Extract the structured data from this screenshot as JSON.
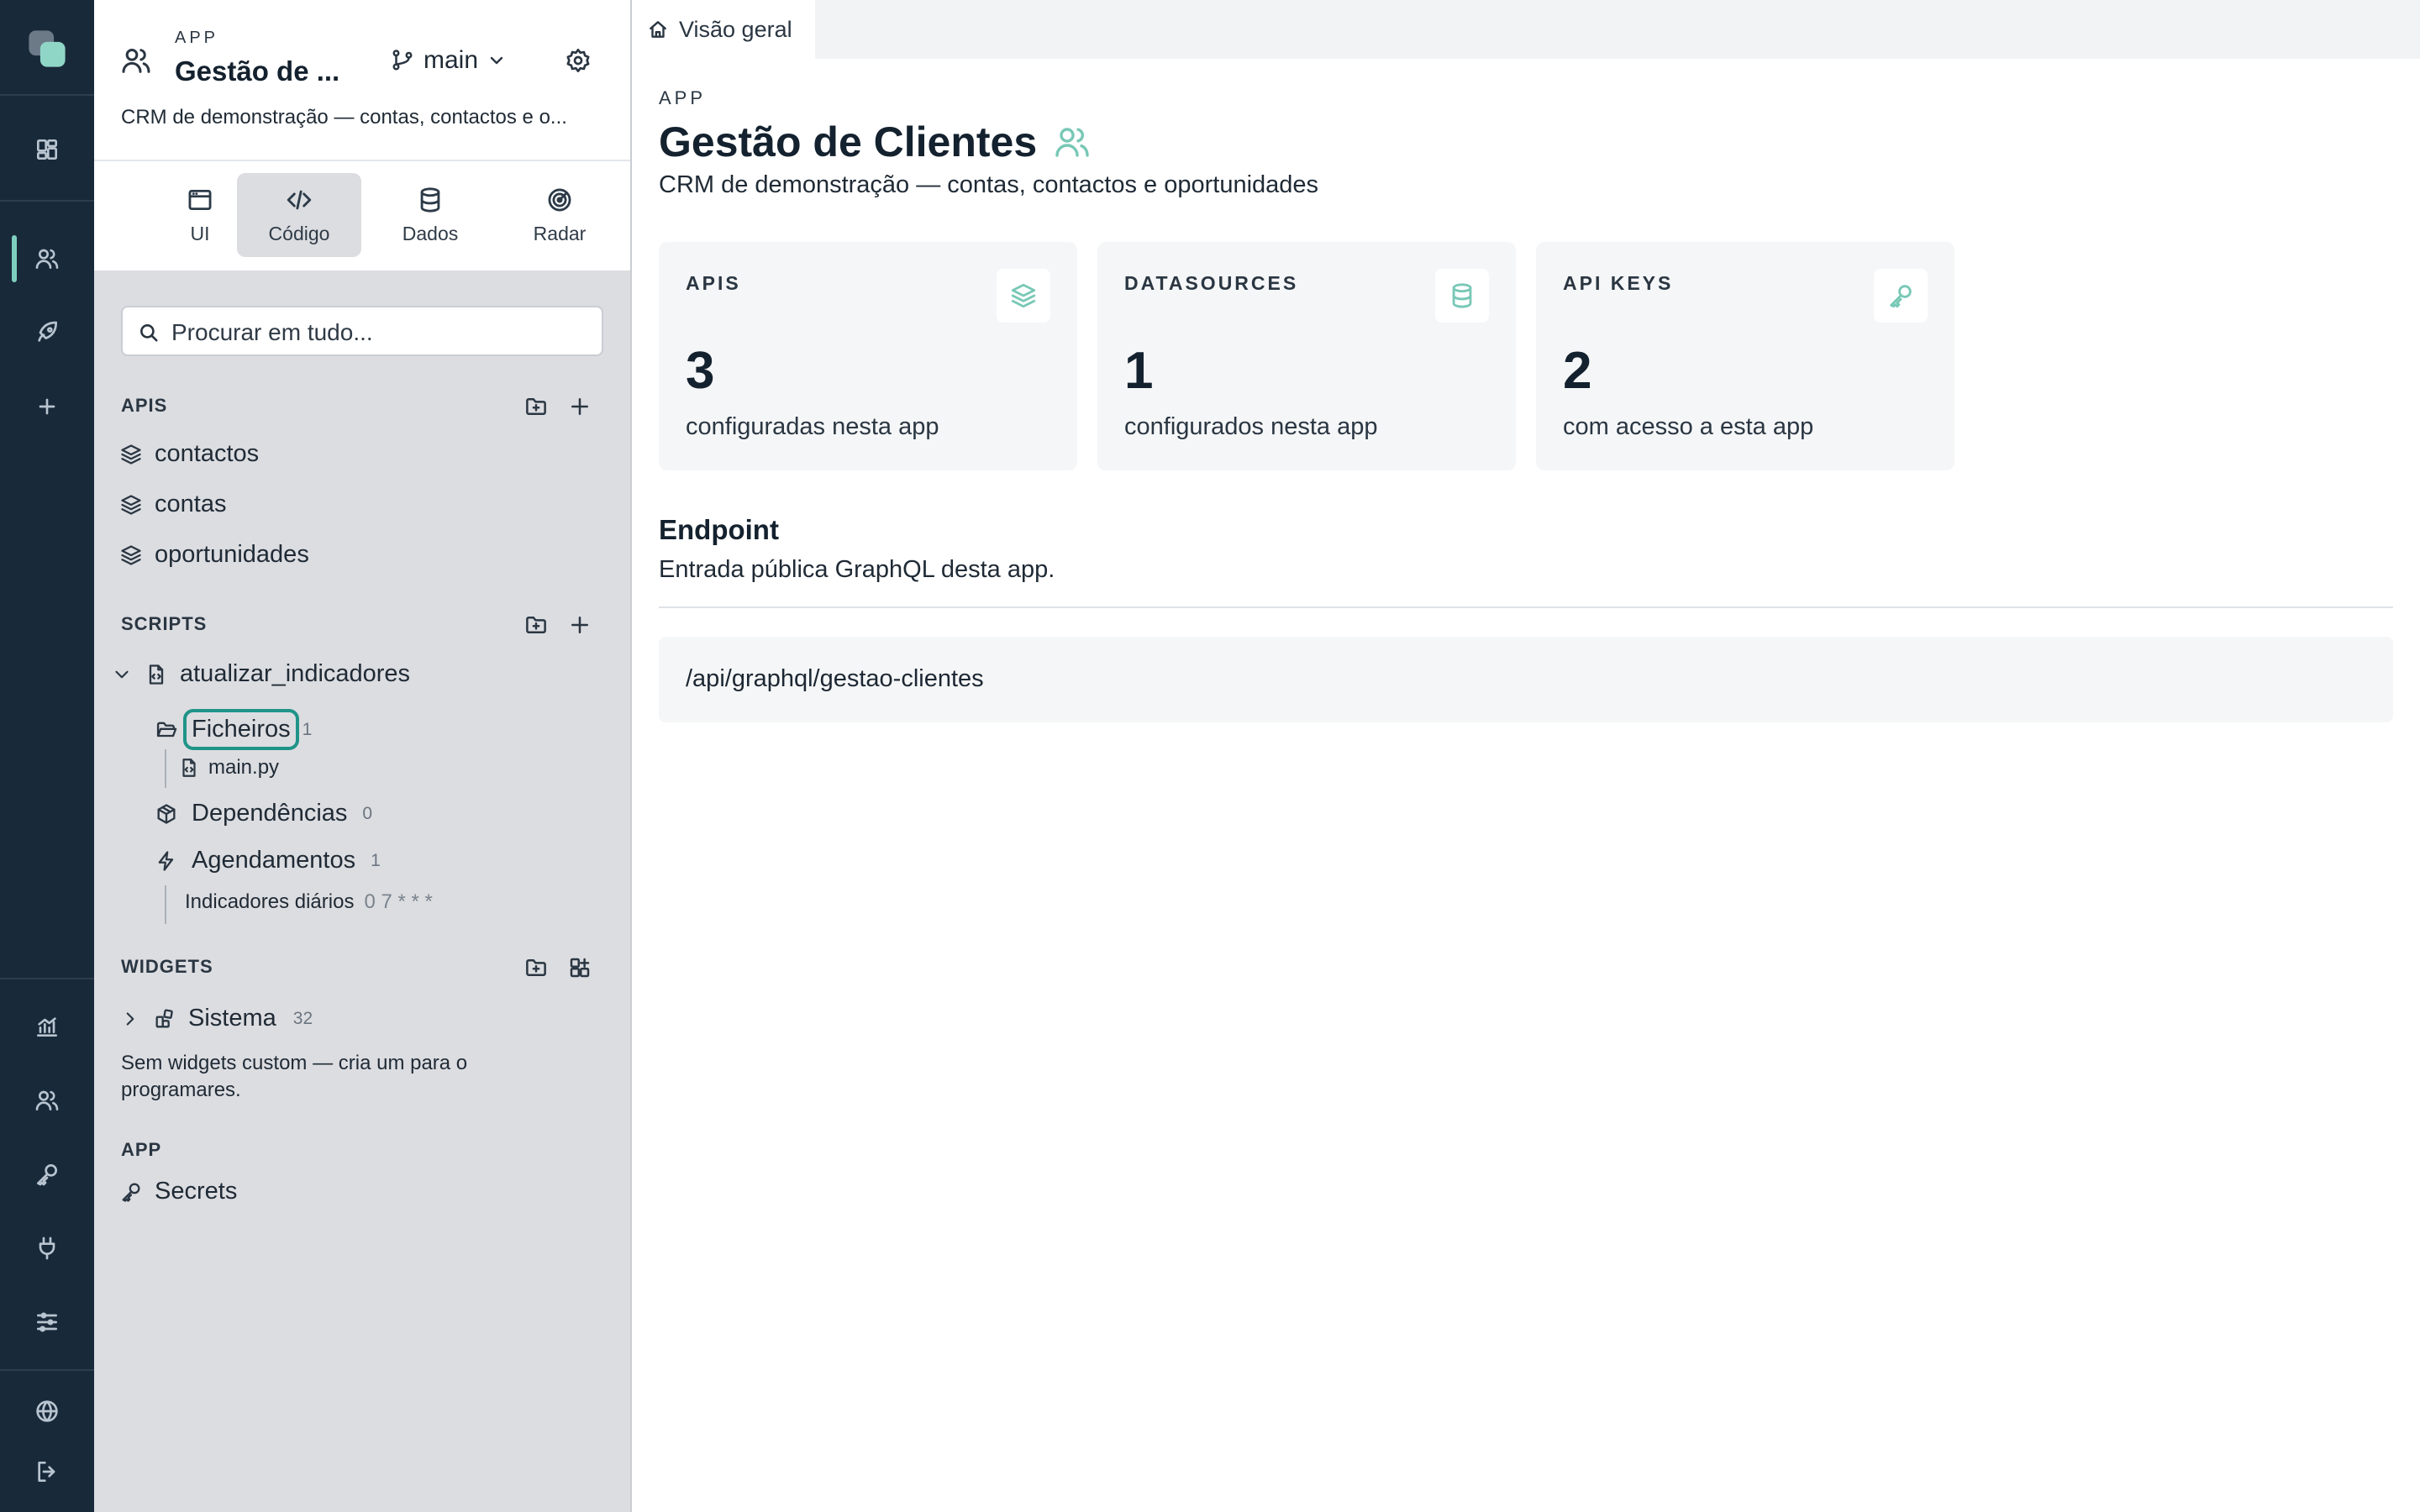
{
  "rail": {
    "icons": [
      "app-logo-icon",
      "dashboard-icon",
      "users-icon",
      "rocket-icon",
      "plus-icon",
      "chart-icon",
      "team-icon",
      "key-icon",
      "plug-icon",
      "sliders-icon",
      "globe-icon",
      "logout-icon"
    ]
  },
  "sidebar": {
    "app_kicker": "APP",
    "app_name": "Gestão de ...",
    "branch": "main",
    "description": "CRM de demonstração — contas, contactos e o...",
    "tabs": [
      {
        "label": "UI"
      },
      {
        "label": "Código"
      },
      {
        "label": "Dados"
      },
      {
        "label": "Radar"
      }
    ],
    "active_tab": "Código",
    "search_placeholder": "Procurar em tudo...",
    "apis": {
      "title": "APIS",
      "items": [
        {
          "label": "contactos"
        },
        {
          "label": "contas"
        },
        {
          "label": "oportunidades"
        }
      ]
    },
    "scripts": {
      "title": "SCRIPTS",
      "script_name": "atualizar_indicadores",
      "files_label": "Ficheiros",
      "files_count": "1",
      "file_name": "main.py",
      "deps_label": "Dependências",
      "deps_count": "0",
      "schedules_label": "Agendamentos",
      "schedules_count": "1",
      "schedule_name": "Indicadores diários",
      "schedule_cron": "0 7 * * *"
    },
    "widgets": {
      "title": "WIDGETS",
      "group_label": "Sistema",
      "group_count": "32",
      "empty_text": "Sem widgets custom — cria um para o programares."
    },
    "app_section": {
      "title": "APP",
      "secrets_label": "Secrets"
    }
  },
  "main": {
    "tab_label": "Visão geral",
    "kicker": "APP",
    "title": "Gestão de Clientes",
    "subtitle": "CRM de demonstração — contas, contactos e oportunidades",
    "cards": [
      {
        "title": "APIS",
        "value": "3",
        "caption": "configuradas nesta app",
        "icon": "layers-icon"
      },
      {
        "title": "DATASOURCES",
        "value": "1",
        "caption": "configurados nesta app",
        "icon": "database-icon"
      },
      {
        "title": "API KEYS",
        "value": "2",
        "caption": "com acesso a esta app",
        "icon": "key-icon"
      }
    ],
    "endpoint": {
      "title": "Endpoint",
      "description": "Entrada pública GraphQL desta app.",
      "url": "/api/graphql/gestao-clientes"
    }
  },
  "colors": {
    "rail_bg": "#18293a",
    "accent": "#78c8b6",
    "sidebar_bg": "#dcdde1",
    "focus_ring": "#1f9488"
  }
}
